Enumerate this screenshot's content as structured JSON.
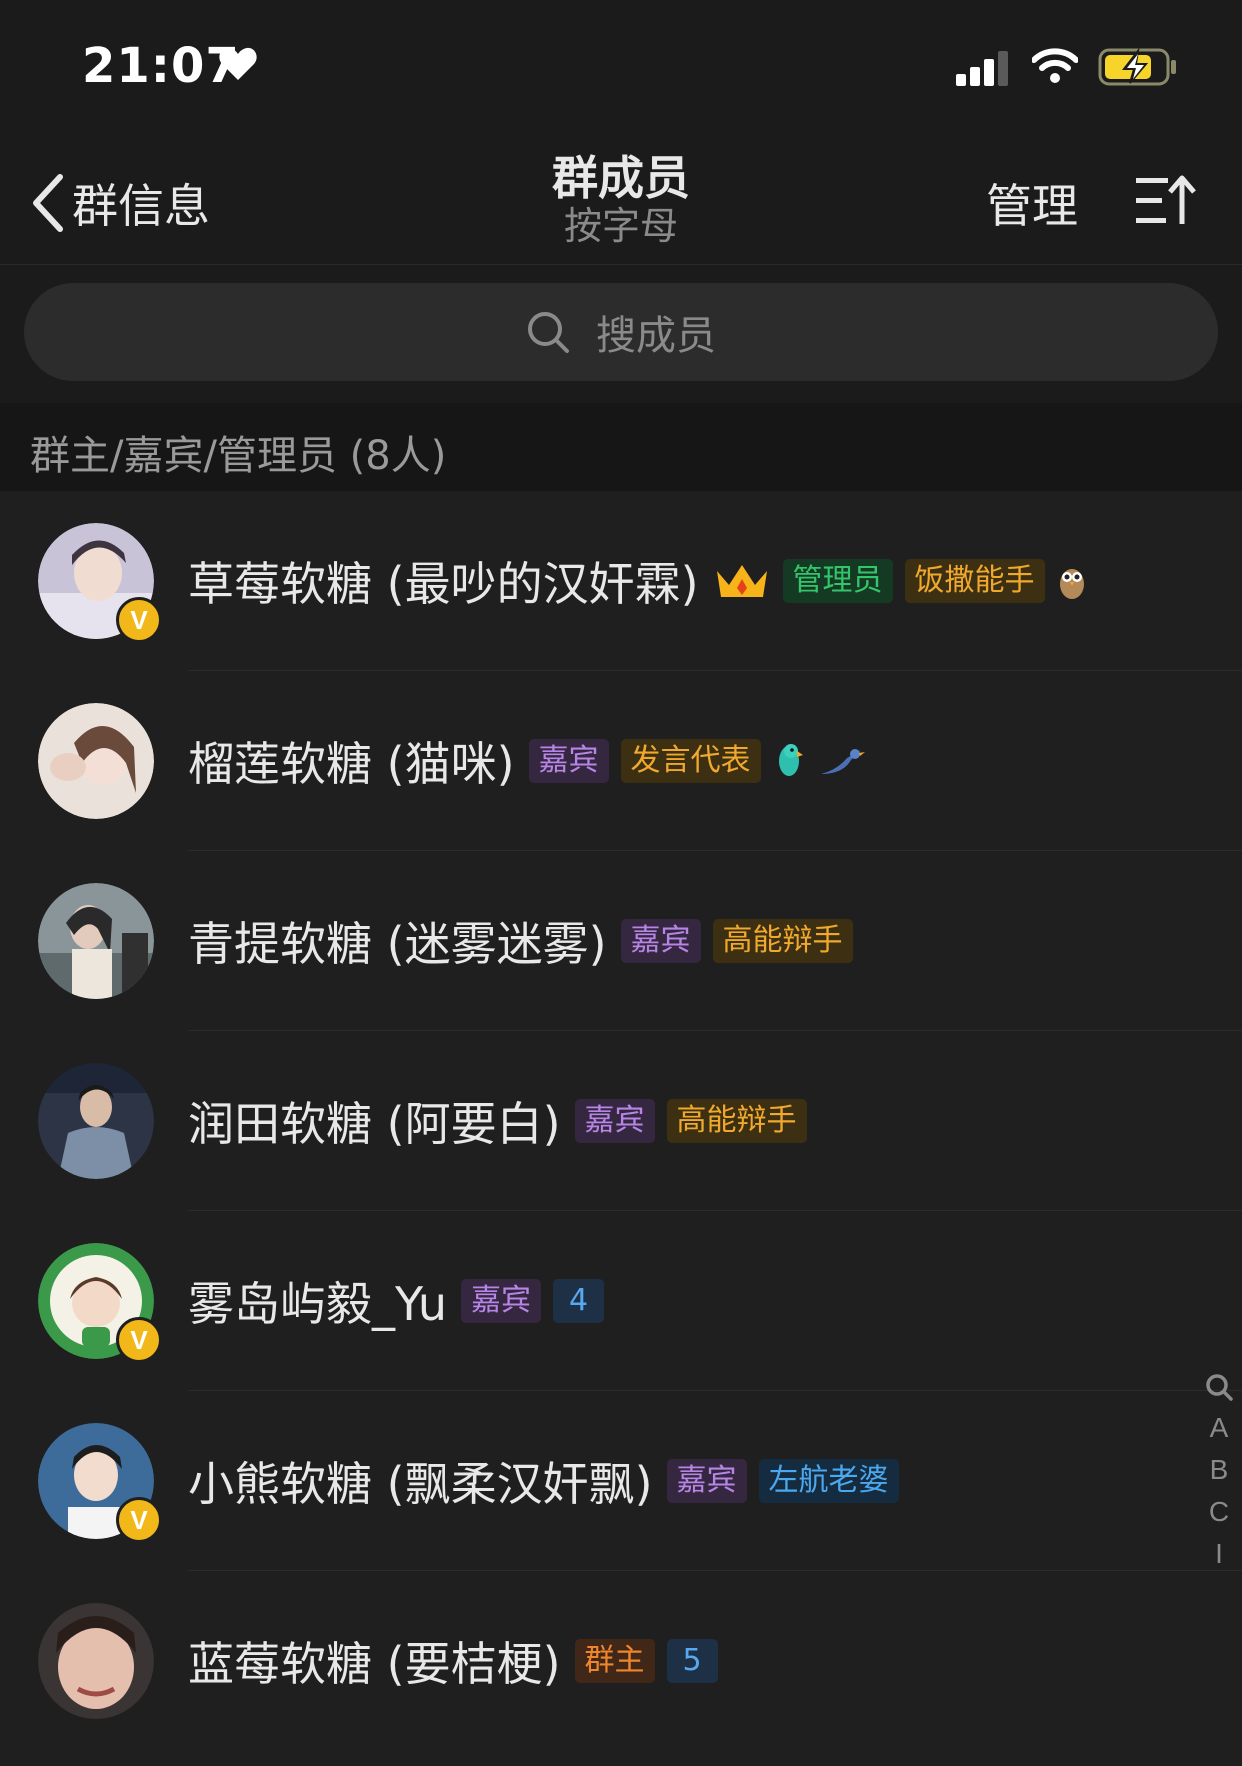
{
  "status_bar": {
    "time": "21:07"
  },
  "nav": {
    "back_label": "群信息",
    "title": "群成员",
    "subtitle": "按字母",
    "manage_label": "管理"
  },
  "search": {
    "placeholder": "搜成员"
  },
  "section": {
    "title": "群主/嘉宾/管理员 (8人)"
  },
  "members": [
    {
      "name": "草莓软糖 (最吵的汉奸霖)",
      "tags": [
        "管理员",
        "饭撒能手"
      ],
      "verified": true
    },
    {
      "name": "榴莲软糖 (猫咪)",
      "tags": [
        "嘉宾",
        "发言代表"
      ],
      "verified": false
    },
    {
      "name": "青提软糖 (迷雾迷雾)",
      "tags": [
        "嘉宾",
        "高能辩手"
      ],
      "verified": false
    },
    {
      "name": "润田软糖 (阿要白)",
      "tags": [
        "嘉宾",
        "高能辩手"
      ],
      "verified": false
    },
    {
      "name": "雾岛屿毅_Yu",
      "tags": [
        "嘉宾",
        "4"
      ],
      "verified": true
    },
    {
      "name": "小熊软糖 (飘柔汉奸飘)",
      "tags": [
        "嘉宾",
        "左航老婆"
      ],
      "verified": true
    },
    {
      "name": "蓝莓软糖 (要桔梗)",
      "tags": [
        "群主",
        "5"
      ],
      "verified": false
    }
  ],
  "verified_mark": "V",
  "index_letters": [
    "A",
    "B",
    "C",
    "I"
  ],
  "colors": {
    "background": "#1f1f1f",
    "guest_tag": "#b785e6",
    "gold_tag": "#f0a92c",
    "admin_tag": "#34c46a",
    "blue_tag": "#4ba8ef",
    "owner_tag": "#f0862c",
    "verified_badge": "#f2b81a"
  }
}
